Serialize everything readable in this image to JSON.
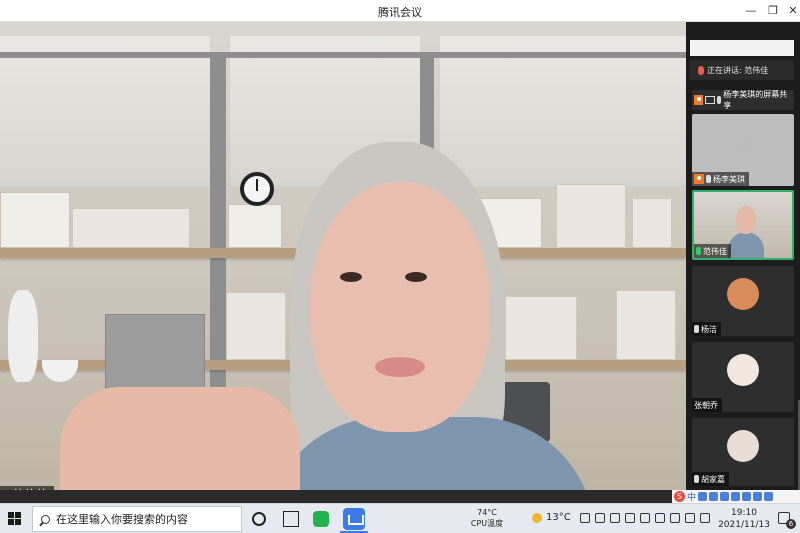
{
  "window": {
    "title": "腾讯会议",
    "min_glyph": "—",
    "max_glyph": "❐",
    "close_glyph": "✕"
  },
  "main_video": {
    "speaker_name": "范伟佳"
  },
  "sidebar": {
    "speaking_label": "正在讲话: 范伟佳",
    "participants": [
      {
        "name": "杨李美琪的屏幕共享",
        "type": "screen-share"
      },
      {
        "name": "杨李美琪",
        "type": "camera-off"
      },
      {
        "name": "范伟佳",
        "type": "video"
      },
      {
        "name": "杨洁",
        "type": "avatar",
        "avatar_color": "#d98b5a"
      },
      {
        "name": "张朝乔",
        "type": "avatar",
        "avatar_color": "#f1e6e0"
      },
      {
        "name": "胡家嘉",
        "type": "avatar",
        "avatar_color": "#e8dcd6"
      }
    ]
  },
  "ime": {
    "logo": "S",
    "mode": "中"
  },
  "taskbar": {
    "search_placeholder": "在这里输入你要搜索的内容",
    "cpu_temp": "74°C",
    "cpu_label": "CPU温度",
    "weather_temp": "13°C",
    "time": "19:10",
    "date": "2021/11/13",
    "notification_count": "6"
  },
  "colors": {
    "accent_green": "#2fb26b",
    "speaking_mic": "#e85b4f",
    "meeting_blue": "#3b7be8"
  }
}
